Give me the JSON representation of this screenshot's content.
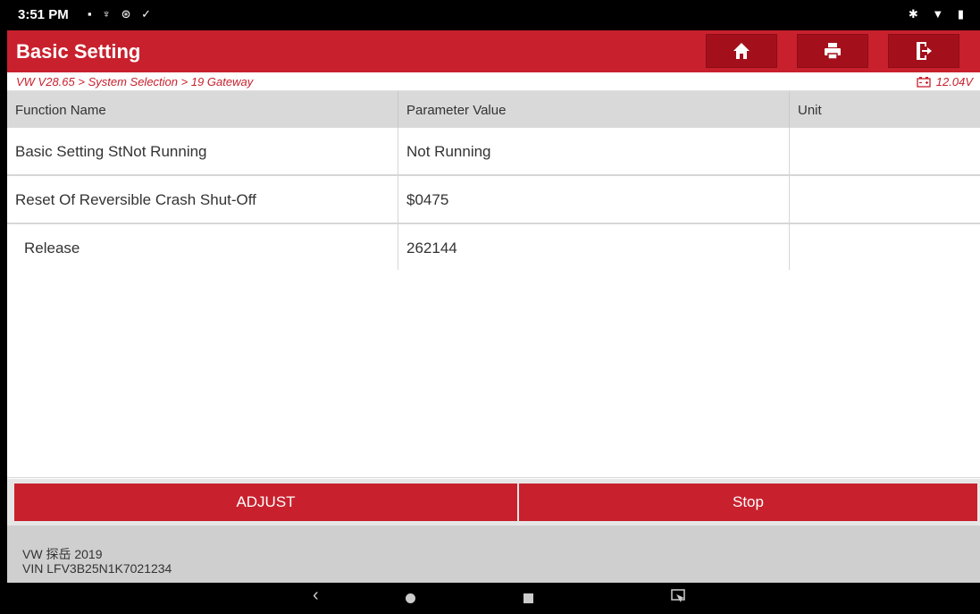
{
  "status_bar": {
    "time": "3:51 PM"
  },
  "header": {
    "title": "Basic Setting",
    "buttons": [
      "home",
      "print",
      "exit"
    ]
  },
  "breadcrumb": {
    "path": "VW V28.65 > System Selection > 19 Gateway",
    "voltage": "12.04V"
  },
  "table": {
    "columns": [
      "Function Name",
      "Parameter Value",
      "Unit"
    ],
    "rows": [
      {
        "name": "Basic Setting StNot Running",
        "value": "Not Running",
        "unit": ""
      },
      {
        "name": "Reset Of Reversible Crash Shut-Off",
        "value": "$0475",
        "unit": ""
      },
      {
        "name": "Release",
        "value": "262144",
        "unit": ""
      }
    ]
  },
  "actions": {
    "adjust_label": "ADJUST",
    "stop_label": "Stop"
  },
  "footer": {
    "vehicle": "VW 探岳 2019",
    "vin": "VIN LFV3B25N1K7021234"
  },
  "colors": {
    "brand_red": "#c8202d",
    "button_dark_red": "#a3101b"
  }
}
